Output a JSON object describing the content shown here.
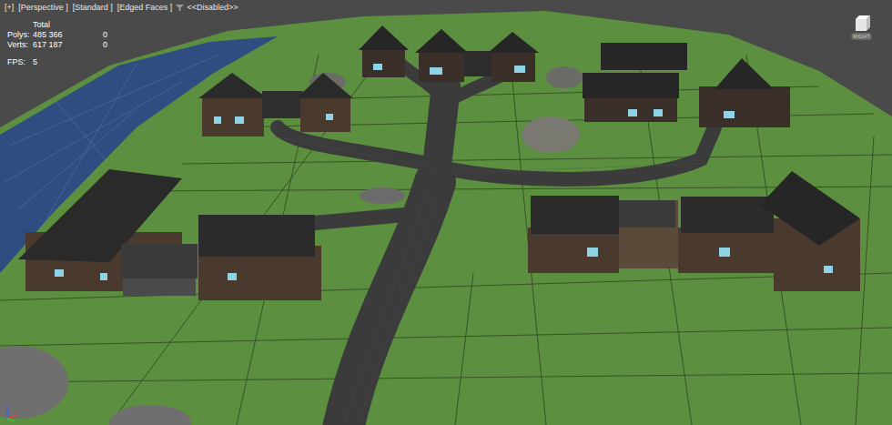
{
  "viewport": {
    "labels": [
      "[+]",
      "[Perspective ]",
      "[Standard ]",
      "[Edged Faces ]"
    ],
    "filter": "<<Disabled>>"
  },
  "stats": {
    "header": "Total",
    "rows": [
      {
        "label": "Polys:",
        "total": "485 366",
        "sel_value": "0"
      },
      {
        "label": "Verts:",
        "total": "617 187",
        "sel_value": "0"
      }
    ],
    "fps_label": "FPS:",
    "fps": "5"
  },
  "viewcube": {
    "face": "RIGHT"
  }
}
